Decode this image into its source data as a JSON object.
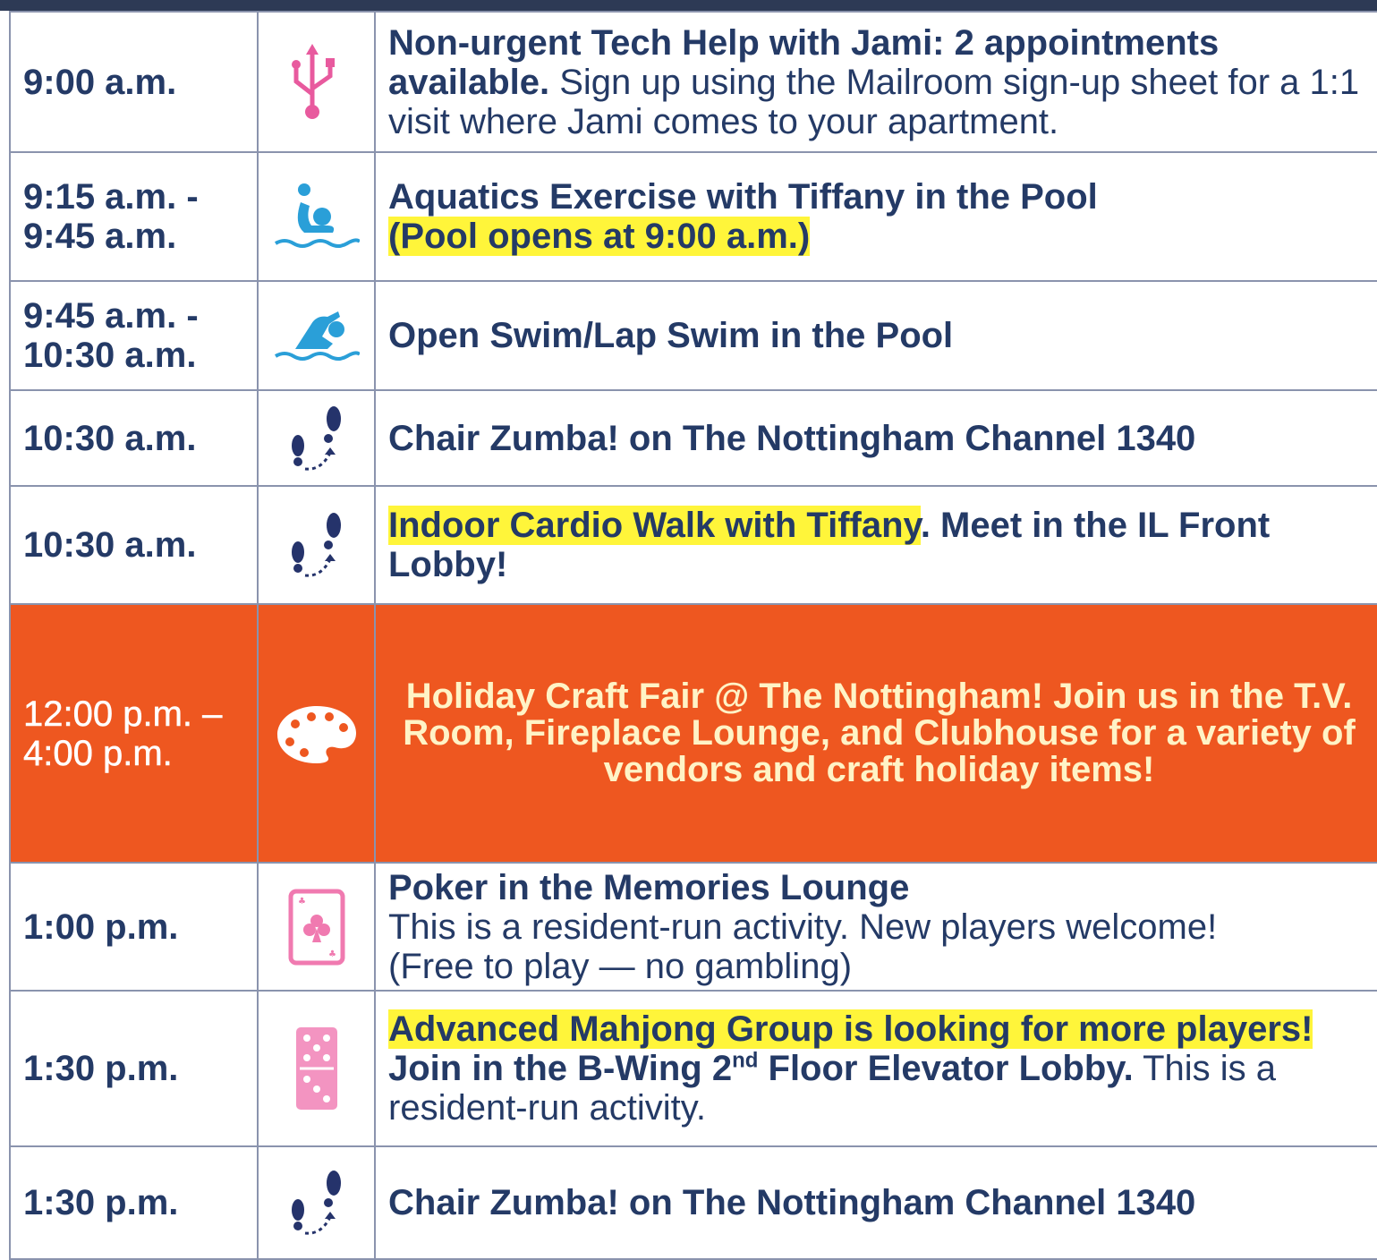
{
  "colors": {
    "text": "#243a66",
    "highlight": "#fff53a",
    "featured_bg": "#ee5720",
    "icon_pink": "#e85a9e",
    "icon_blue": "#2a9fd8",
    "icon_navy": "#25336b"
  },
  "rows": [
    {
      "time_1": "9:00 a.m.",
      "icon": "usb-icon",
      "title": "Non-urgent Tech Help with Jami: 2 appointments available.",
      "body": " Sign up using the Mailroom sign-up sheet for a 1:1 visit where Jami comes to your apartment."
    },
    {
      "time_1": "9:15 a.m. -",
      "time_2": "9:45 a.m.",
      "icon": "water-aerobics-icon",
      "title": "Aquatics Exercise with Tiffany in the Pool",
      "note": "(Pool opens at 9:00 a.m.)"
    },
    {
      "time_1": "9:45 a.m. -",
      "time_2": "10:30 a.m.",
      "icon": "swimmer-icon",
      "title": "Open Swim/Lap Swim in the Pool"
    },
    {
      "time_1": "10:30 a.m.",
      "icon": "footsteps-icon",
      "title": "Chair Zumba! on The Nottingham Channel 1340"
    },
    {
      "time_1": "10:30 a.m.",
      "icon": "footsteps-icon",
      "title_highlight": "Indoor Cardio Walk with Tiffany",
      "title": ". Meet in the IL Front Lobby!"
    },
    {
      "time_1": "12:00 p.m. –",
      "time_2": "4:00 p.m.",
      "icon": "paint-palette-icon",
      "title": "Holiday Craft Fair @ The Nottingham! Join us in the T.V. Room, Fireplace Lounge, and Clubhouse for a variety of vendors and craft holiday items!"
    },
    {
      "time_1": "1:00 p.m.",
      "icon": "playing-card-icon",
      "title": "Poker in the Memories Lounge",
      "line_2": "This is a resident-run activity. New players welcome!",
      "line_3": "(Free to play — no gambling)"
    },
    {
      "time_1": "1:30 p.m.",
      "icon": "domino-icon",
      "title_highlight": "Advanced Mahjong Group is looking for more players!",
      "title_a": "Join in the B-Wing 2",
      "title_sup": "nd",
      "title_b": " Floor Elevator Lobby.",
      "body": " This is a resident-run activity."
    },
    {
      "time_1": "1:30 p.m.",
      "icon": "footsteps-icon",
      "title": "Chair Zumba! on The Nottingham Channel 1340"
    }
  ]
}
